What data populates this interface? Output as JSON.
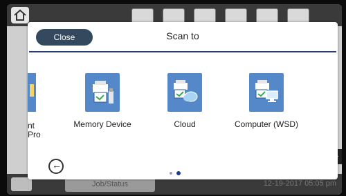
{
  "background": {
    "job_status_label": "Job/Status",
    "datetime": "12-19-2017 05:05 pm"
  },
  "dialog": {
    "title": "Scan to",
    "close_label": "Close",
    "partial_item_label_line1": "nt",
    "partial_item_label_line2": "Pro",
    "items": [
      {
        "label": "Memory Device",
        "icon": "memory-device-icon"
      },
      {
        "label": "Cloud",
        "icon": "cloud-icon"
      },
      {
        "label": "Computer (WSD)",
        "icon": "computer-icon"
      }
    ],
    "pagination": {
      "current": 2,
      "total": 2
    }
  },
  "colors": {
    "tile": "#5488c9",
    "close_button": "#34495e",
    "header_line": "#2a3f73",
    "active_dot": "#1f3a8a"
  }
}
